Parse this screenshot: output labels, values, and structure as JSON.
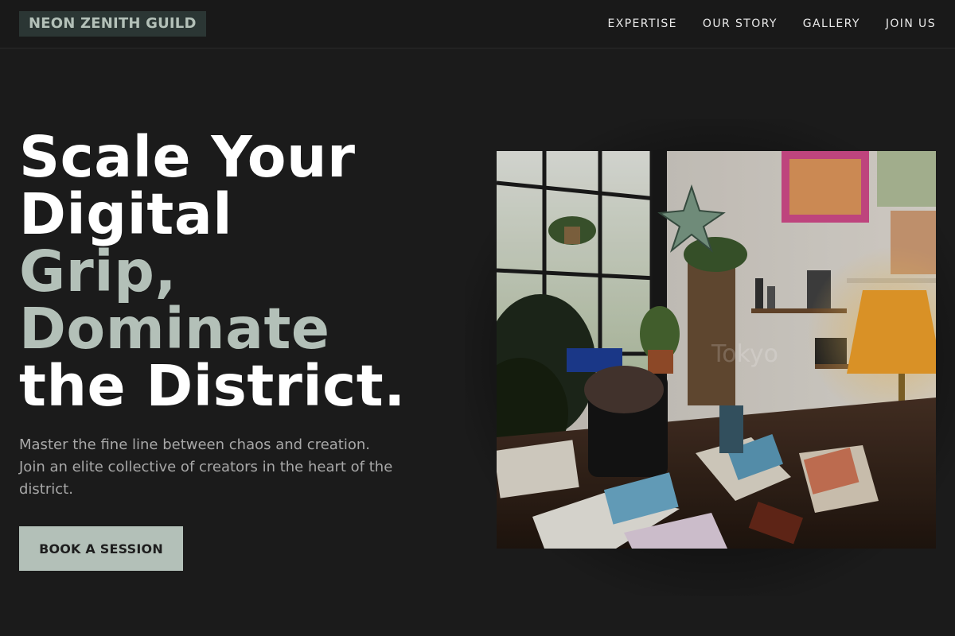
{
  "brand": {
    "name": "NEON ZENITH GUILD"
  },
  "nav": {
    "items": [
      {
        "label": "EXPERTISE"
      },
      {
        "label": "OUR STORY"
      },
      {
        "label": "GALLERY"
      },
      {
        "label": "JOIN US"
      }
    ]
  },
  "hero": {
    "headline_lines": [
      {
        "text": "Scale Your"
      },
      {
        "text": "Digital"
      },
      {
        "text": "Grip,"
      },
      {
        "text": "Dominate"
      },
      {
        "text": "the District."
      }
    ],
    "subtitle": "Master the fine line between chaos and creation. Join an elite collective of creators in the heart of the district.",
    "cta_label": "BOOK A SESSION",
    "image_watermark": "Tokyo"
  },
  "colors": {
    "background": "#1b1b1b",
    "accent": "#b3c0b8",
    "logo_bg": "#2b3634",
    "text_primary": "#ffffff",
    "text_secondary": "#a8a8a8"
  }
}
